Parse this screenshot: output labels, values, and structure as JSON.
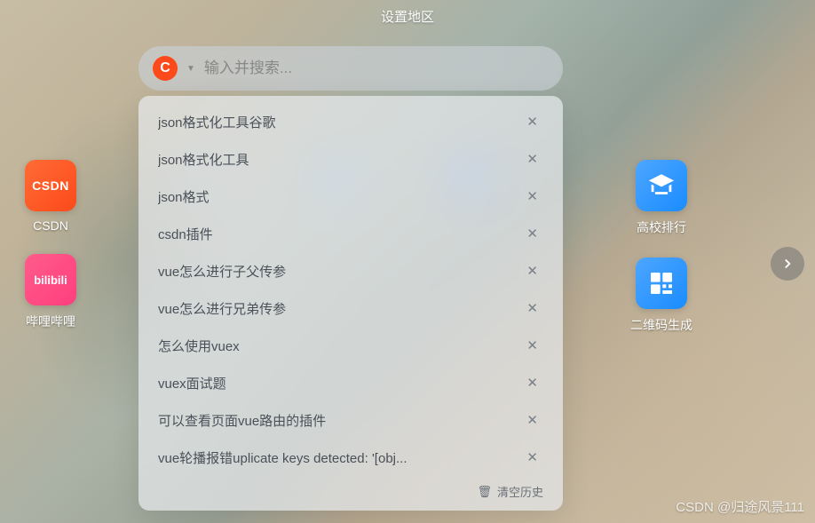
{
  "header": {
    "title": "设置地区"
  },
  "search": {
    "logo_letter": "C",
    "placeholder": "输入并搜索..."
  },
  "suggestions": [
    "json格式化工具谷歌",
    "json格式化工具",
    "json格式",
    "csdn插件",
    "vue怎么进行子父传参",
    "vue怎么进行兄弟传参",
    "怎么使用vuex",
    "vuex面试题",
    "可以查看页面vue路由的插件",
    "vue轮播报错uplicate keys detected: '[obj..."
  ],
  "clear_history_label": "清空历史",
  "shortcuts_left": [
    {
      "id": "csdn",
      "label": "CSDN",
      "logo_text": "CSDN"
    },
    {
      "id": "bilibili",
      "label": "哔哩哔哩",
      "logo_text": "bilibili"
    }
  ],
  "shortcuts_right": [
    {
      "id": "school-rank",
      "label": "高校排行"
    },
    {
      "id": "qr-gen",
      "label": "二维码生成"
    }
  ],
  "watermark": "CSDN @归途风景111"
}
